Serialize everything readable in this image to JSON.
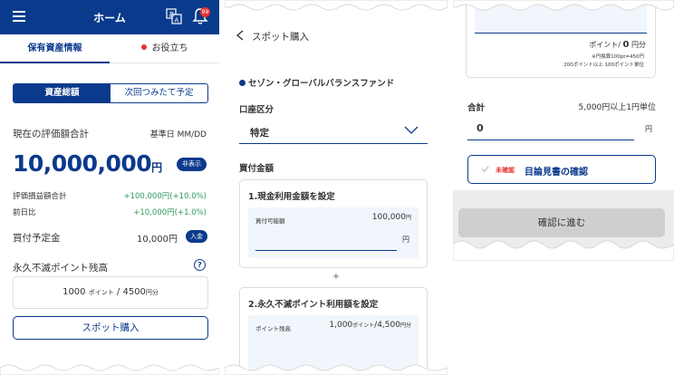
{
  "screen1": {
    "header": {
      "title": "ホーム",
      "notification_count": "99"
    },
    "tabs": [
      {
        "label": "保有資産情報"
      },
      {
        "label": "お役立ち"
      }
    ],
    "segment": {
      "active": "資産総額",
      "inactive": "次回つみたて予定"
    },
    "valuation": {
      "label": "現在の評価額合計",
      "base_date": "基準日 MM/DD",
      "amount": "10,000,000",
      "unit": "円",
      "hide_label": "非表示"
    },
    "pnl": {
      "total_label": "評価損益額合計",
      "total_value": "+100,000円(+10.0%)",
      "daily_label": "前日比",
      "daily_value": "+10,000円(+1.0%)"
    },
    "planned": {
      "label": "買付予定金",
      "value": "10,000円",
      "deposit_label": "入金"
    },
    "points": {
      "label": "永久不滅ポイント残高",
      "help": "?",
      "amount": "1000",
      "points_unit": "ポイント",
      "separator": "/",
      "yen_amount": "4500",
      "yen_unit": "円分"
    },
    "spot_button": "スポット購入"
  },
  "screen2": {
    "title": "スポット購入",
    "fund_name": "セゾン・グローバルバランスファンド",
    "account": {
      "label": "口座区分",
      "value": "特定"
    },
    "purchase": {
      "label": "買付金額",
      "cash": {
        "title": "1.現金利用金額を設定",
        "available_label": "買付可能額",
        "available_value": "100,000",
        "available_unit": "円",
        "input_unit": "円"
      },
      "plus": "+",
      "points": {
        "title": "2.永久不滅ポイント利用額を設定",
        "balance_label": "ポイント残高",
        "balance_points": "1,000",
        "points_unit": "ポイント",
        "balance_yen": "/4,500",
        "yen_unit": "円分"
      }
    }
  },
  "screen3": {
    "points_line": {
      "label": "ポイント/",
      "value": "0",
      "unit": "円分"
    },
    "note1": "※円換算100pt=450円",
    "note2": "200ポイント以上 100ポイント単位",
    "sum": {
      "label": "合計",
      "note": "5,000円以上1円単位",
      "value": "0",
      "unit": "円"
    },
    "doc_confirm": {
      "status": "未確認",
      "label": "目論見書の確認"
    },
    "proceed_button": "確認に進む"
  },
  "colors": {
    "brand": "#0a3a8c",
    "gain": "#2e9a5a",
    "alert": "#e6322f",
    "input_bg": "#f0f6fb"
  }
}
